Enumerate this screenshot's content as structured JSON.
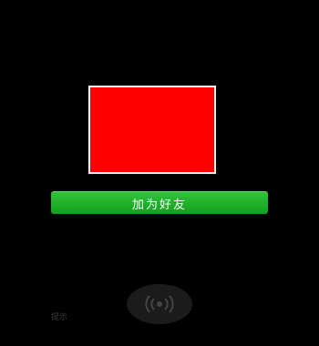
{
  "profile": {
    "photo_color": "#ff0000"
  },
  "actions": {
    "add_friend_label": "加为好友",
    "accent_color": "#1aad19"
  },
  "footer": {
    "hint_text": "提示",
    "shake_icon": "radar-wave-icon"
  }
}
